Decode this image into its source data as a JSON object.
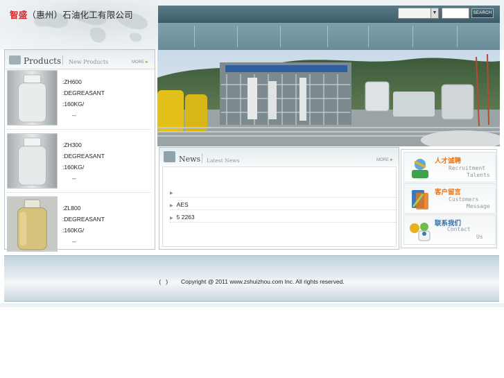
{
  "header": {
    "company_name_accent": "智盛",
    "company_name_rest": "（惠州）石油化工有限公司",
    "search": {
      "select_value": "",
      "input_placeholder": "",
      "button_label": "SEARCH"
    }
  },
  "products": {
    "title": "Products",
    "subtitle": "New Products",
    "more_label": "MORE",
    "items": [
      {
        "name": ":ZH600",
        "type": ":DEGREASANT",
        "weight": ":160KG/",
        "extra": "--"
      },
      {
        "name": ":ZH300",
        "type": ":DEGREASANT",
        "weight": ":160KG/",
        "extra": "--"
      },
      {
        "name": ":ZL800",
        "type": ":DEGREASANT",
        "weight": ":160KG/",
        "extra": "--"
      }
    ]
  },
  "news": {
    "title": "News",
    "subtitle": "Latest  News",
    "more_label": "MORE",
    "items": [
      {
        "text": ""
      },
      {
        "text": "AES"
      },
      {
        "text": "5     2263"
      }
    ]
  },
  "services": [
    {
      "cn": "人才诚聘",
      "en1": "Recruitment",
      "en2": "Talents",
      "color": "#e8751a"
    },
    {
      "cn": "客户留言",
      "en1": "Customers",
      "en2": "Message",
      "color": "#e8751a"
    },
    {
      "cn": "联系我们",
      "en1": "Contact",
      "en2": "Us",
      "color": "#2f6fb3"
    }
  ],
  "footer": {
    "text": "(   )        Copyright @ 2011 www.zshuizhou.com Inc. All rights reserved."
  },
  "colors": {
    "brand_red": "#d8262b",
    "nav_teal": "#6a8c99",
    "more_arrow": "#8ab43c"
  },
  "icons": [
    "triangle-bullet-icon",
    "dropdown-arrow-icon",
    "recruitment-icon",
    "message-icon",
    "contact-icon"
  ]
}
